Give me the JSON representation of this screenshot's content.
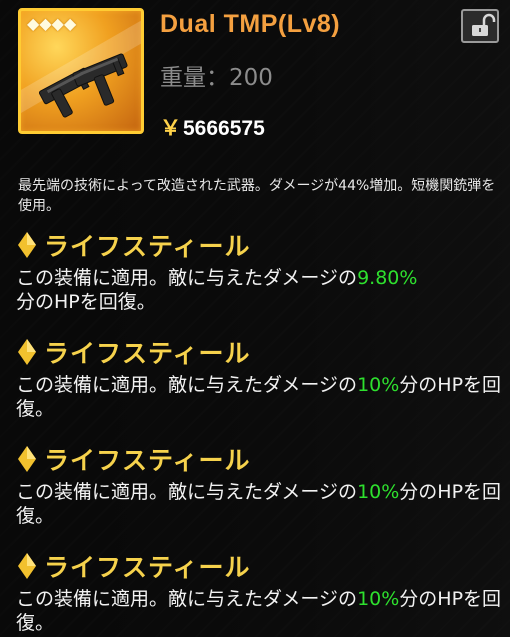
{
  "item": {
    "name": "Dual TMP(Lv8)",
    "rarity_stars": 4,
    "weight_label": "重量：",
    "weight_value": "200",
    "currency_symbol": "￥",
    "price": "5666575",
    "icon": "dual-smg-icon",
    "lock_icon": "unlocked-padlock-icon"
  },
  "description": "最先端の技術によって改造された武器。ダメージが44%増加。短機関銃弾を使用。",
  "skills": [
    {
      "name": "ライフスティール",
      "text_before": "この装備に適用。敵に与えたダメージの",
      "value": "9.80%",
      "text_after": "分のHPを回復。"
    },
    {
      "name": "ライフスティール",
      "text_before": "この装備に適用。敵に与えたダメージの",
      "value": "10%",
      "text_after": "分のHPを回復。"
    },
    {
      "name": "ライフスティール",
      "text_before": "この装備に適用。敵に与えたダメージの",
      "value": "10%",
      "text_after": "分のHPを回復。"
    },
    {
      "name": "ライフスティール",
      "text_before": "この装備に適用。敵に与えたダメージの",
      "value": "10%",
      "text_after": "分のHPを回復。"
    }
  ],
  "colors": {
    "title": "#f4a040",
    "skill_name": "#f6d24c",
    "highlight_value": "#2ee02e",
    "icon_border": "#ffcc33"
  }
}
